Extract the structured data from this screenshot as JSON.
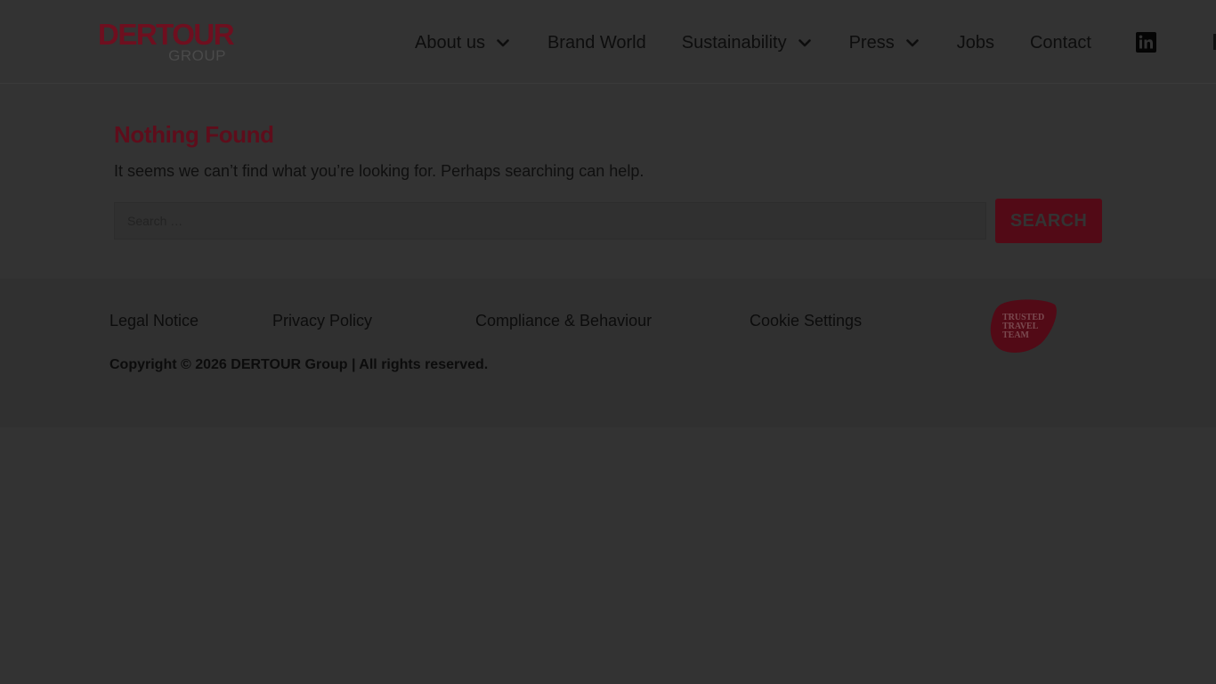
{
  "header": {
    "logo": {
      "main": "DERTOUR",
      "sub": "GROUP"
    },
    "nav": [
      {
        "label": "About us",
        "has_dropdown": true
      },
      {
        "label": "Brand World",
        "has_dropdown": false
      },
      {
        "label": "Sustainability",
        "has_dropdown": true
      },
      {
        "label": "Press",
        "has_dropdown": true
      },
      {
        "label": "Jobs",
        "has_dropdown": false
      },
      {
        "label": "Contact",
        "has_dropdown": false
      }
    ],
    "social_icon": "linkedin-icon"
  },
  "main": {
    "title": "Nothing Found",
    "lead": "It seems we can’t find what you’re looking for. Perhaps searching can help.",
    "search": {
      "placeholder": "Search …",
      "value": "",
      "button_label": "SEARCH"
    }
  },
  "footer": {
    "links": [
      "Legal Notice",
      "Privacy Policy",
      "Compliance & Behaviour",
      "Cookie Settings"
    ],
    "copyright": "Copyright © 2026 DERTOUR Group | All rights reserved.",
    "badge": {
      "lines": [
        "TRUSTED",
        "TRAVEL",
        "TEAM"
      ]
    }
  },
  "colors": {
    "overlay_background": "#333333",
    "brand_red": "#6e0f1f",
    "button_red": "#520a16",
    "text_dark": "#0d0d0d"
  }
}
